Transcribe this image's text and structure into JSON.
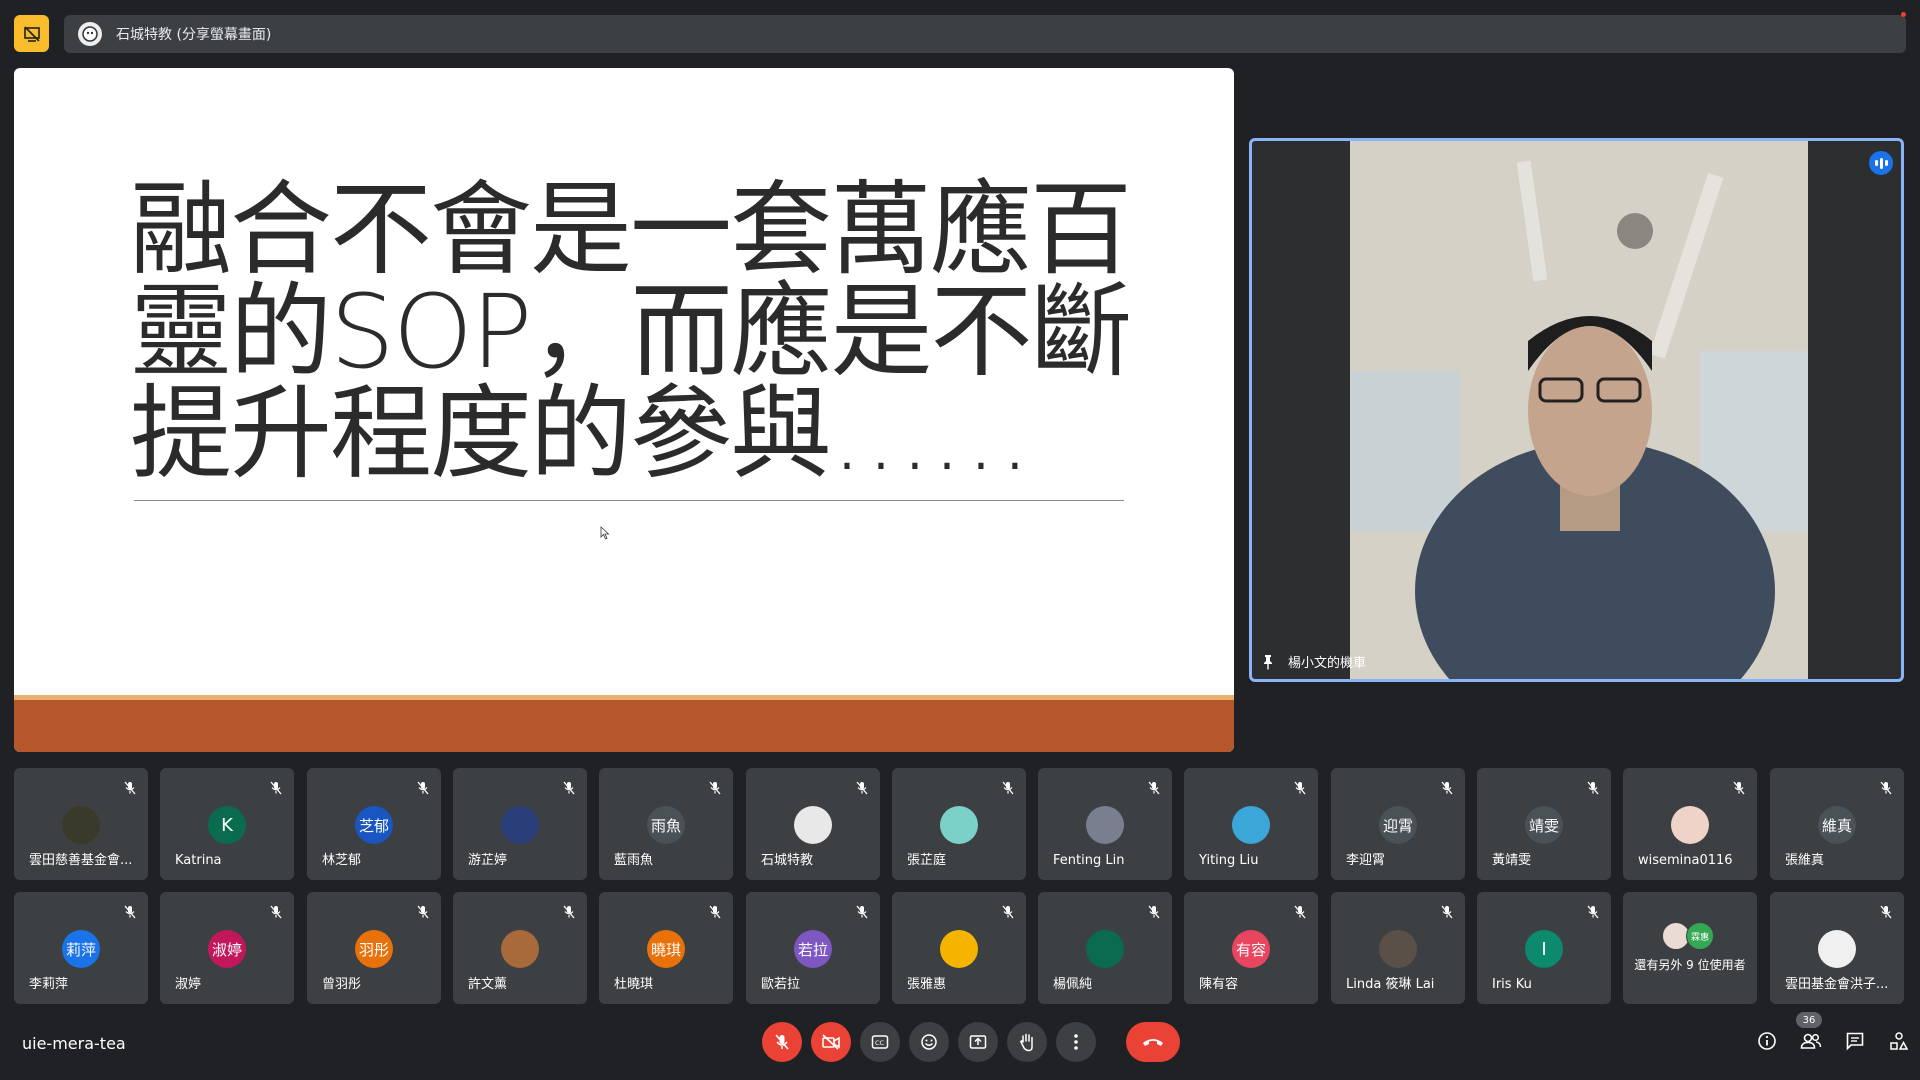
{
  "presenter": {
    "name": "石城特教 (分享螢幕畫面)"
  },
  "slide": {
    "title": "融合不會是一套萬應百靈的SOP，而應是不斷提升程度的參與……"
  },
  "spotlight": {
    "name": "楊小文的機車"
  },
  "participants": [
    {
      "name": "雲田慈善基金會...",
      "initials": "",
      "color": "#3a3a2a"
    },
    {
      "name": "Katrina",
      "initials": "K",
      "color": "#0b6b4e"
    },
    {
      "name": "林芝郁",
      "initials": "芝郁",
      "color": "#1a56c2"
    },
    {
      "name": "游芷婷",
      "initials": "",
      "color": "#2a3f7a"
    },
    {
      "name": "藍雨魚",
      "initials": "雨魚",
      "color": "#4a5258"
    },
    {
      "name": "石城特教",
      "initials": "",
      "color": "#e8e8e8"
    },
    {
      "name": "張芷庭",
      "initials": "",
      "color": "#7bd0c8"
    },
    {
      "name": "Fenting Lin",
      "initials": "",
      "color": "#7a7f8f"
    },
    {
      "name": "Yiting Liu",
      "initials": "",
      "color": "#3aa7d8"
    },
    {
      "name": "李迎霄",
      "initials": "迎霄",
      "color": "#4a5258"
    },
    {
      "name": "黃靖雯",
      "initials": "靖雯",
      "color": "#4a5258"
    },
    {
      "name": "wisemina0116",
      "initials": "",
      "color": "#f0d3c8"
    },
    {
      "name": "張維真",
      "initials": "維真",
      "color": "#4a5258"
    },
    {
      "name": "李莉萍",
      "initials": "莉萍",
      "color": "#1a73e8"
    },
    {
      "name": "淑婷",
      "initials": "淑婷",
      "color": "#c2185b"
    },
    {
      "name": "曾羽彤",
      "initials": "羽彤",
      "color": "#e8710a"
    },
    {
      "name": "許文薰",
      "initials": "",
      "color": "#a86a3a"
    },
    {
      "name": "杜曉琪",
      "initials": "曉琪",
      "color": "#e8710a"
    },
    {
      "name": "歐若拉",
      "initials": "若拉",
      "color": "#7e57c2"
    },
    {
      "name": "張雅惠",
      "initials": "",
      "color": "#f5b400"
    },
    {
      "name": "楊佩純",
      "initials": "",
      "color": "#0b6b4e"
    },
    {
      "name": "陳有容",
      "initials": "有容",
      "color": "#e8455f"
    },
    {
      "name": "Linda 筱琳 Lai",
      "initials": "",
      "color": "#5a5048"
    },
    {
      "name": "Iris Ku",
      "initials": "I",
      "color": "#0b8a6e"
    },
    {
      "name": "還有另外 9 位使用者",
      "initials": "",
      "color": "#3c4043"
    },
    {
      "name": "雲田基金會洪子...",
      "initials": "",
      "color": "#f0f0f0"
    }
  ],
  "others_avatar_label": "霖惠",
  "meeting": {
    "code": "uie-mera-tea",
    "participant_count": "36"
  },
  "colors": {
    "accent": "#8ab4f8",
    "danger": "#ea4335",
    "present": "#f9bd2b"
  }
}
